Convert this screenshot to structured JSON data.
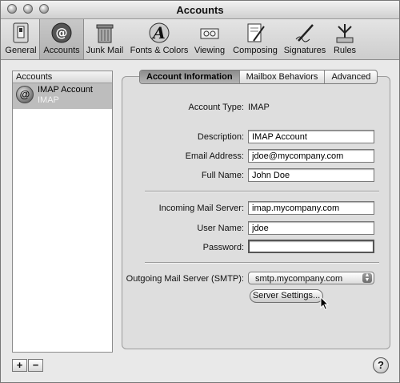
{
  "window": {
    "title": "Accounts"
  },
  "toolbar": {
    "items": [
      {
        "label": "General"
      },
      {
        "label": "Accounts"
      },
      {
        "label": "Junk Mail"
      },
      {
        "label": "Fonts & Colors"
      },
      {
        "label": "Viewing"
      },
      {
        "label": "Composing"
      },
      {
        "label": "Signatures"
      },
      {
        "label": "Rules"
      }
    ]
  },
  "sidebar": {
    "header": "Accounts",
    "account": {
      "name": "IMAP Account",
      "type": "IMAP",
      "icon": "at-sign-icon"
    },
    "add_label": "+",
    "remove_label": "−"
  },
  "tabs": [
    "Account Information",
    "Mailbox Behaviors",
    "Advanced"
  ],
  "form": {
    "account_type_label": "Account Type:",
    "account_type_value": "IMAP",
    "description_label": "Description:",
    "description_value": "IMAP Account",
    "email_label": "Email Address:",
    "email_value": "jdoe@mycompany.com",
    "fullname_label": "Full Name:",
    "fullname_value": "John Doe",
    "incoming_label": "Incoming Mail Server:",
    "incoming_value": "imap.mycompany.com",
    "username_label": "User Name:",
    "username_value": "jdoe",
    "password_label": "Password:",
    "password_value": "",
    "smtp_label": "Outgoing Mail Server (SMTP):",
    "smtp_value": "smtp.mycompany.com",
    "server_settings_button": "Server Settings..."
  },
  "help": {
    "label": "?"
  }
}
